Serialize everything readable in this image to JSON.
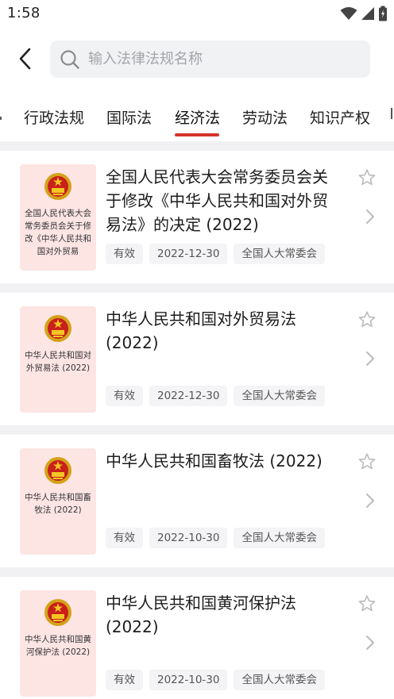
{
  "status_bar": {
    "time": "1:58"
  },
  "search": {
    "placeholder": "输入法律法规名称"
  },
  "tabs": {
    "items": [
      {
        "label": "行政法规"
      },
      {
        "label": "国际法"
      },
      {
        "label": "经济法"
      },
      {
        "label": "劳动法"
      },
      {
        "label": "知识产权"
      }
    ],
    "active_index": 2
  },
  "colors": {
    "accent": "#d6342a",
    "thumb_bg": "#fde5e4",
    "tag_bg": "#f4f4f6",
    "divider": "#f1f1f3"
  },
  "icons": {
    "back": "back-arrow-icon",
    "search": "search-icon",
    "favorite": "star-outline-icon",
    "open": "chevron-right-icon",
    "emblem": "national-emblem-icon",
    "wifi": "wifi-icon",
    "signal": "signal-icon",
    "battery": "battery-icon"
  },
  "laws": [
    {
      "thumb_text": "全国人民代表大会常务委员会关于修改《中华人民共和国对外贸易",
      "title": "全国人民代表大会常务委员会关于修改《中华人民共和国对外贸易法》的决定 (2022)",
      "status": "有效",
      "date": "2022-12-30",
      "issuer": "全国人大常委会"
    },
    {
      "thumb_text": "中华人民共和国对外贸易法 (2022)",
      "title": "中华人民共和国对外贸易法 (2022)",
      "status": "有效",
      "date": "2022-12-30",
      "issuer": "全国人大常委会"
    },
    {
      "thumb_text": "中华人民共和国畜牧法 (2022)",
      "title": "中华人民共和国畜牧法 (2022)",
      "status": "有效",
      "date": "2022-10-30",
      "issuer": "全国人大常委会"
    },
    {
      "thumb_text": "中华人民共和国黄河保护法 (2022)",
      "title": "中华人民共和国黄河保护法 (2022)",
      "status": "有效",
      "date": "2022-10-30",
      "issuer": "全国人大常委会"
    }
  ]
}
